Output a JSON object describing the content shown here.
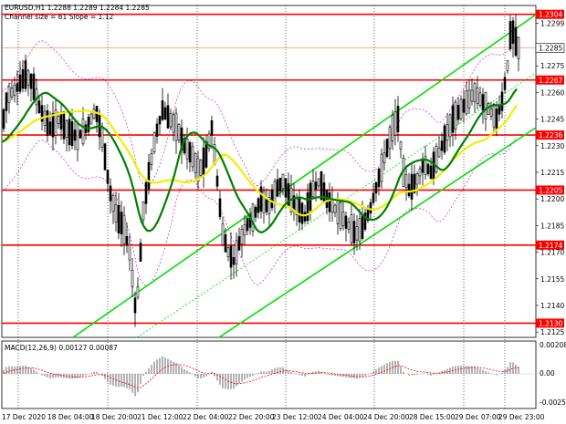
{
  "header": {
    "symbol_line": "EURUSD,H1  1.2288 1.2289 1.2284 1.2285",
    "indicator_line": "Channel size = 61 Slope = 1.12"
  },
  "colors": {
    "bull_candle": "#000000",
    "bear_candle": "#000000",
    "level_line": "#ff0000",
    "channel": "#00e000",
    "ma_yellow": "#f0f000",
    "ma_green": "#008000",
    "bollinger": "#c000c0",
    "macd_hist": "#a0a0a0",
    "macd_signal": "#ff0000",
    "current_price_line": "#ff8040"
  },
  "chart_data": {
    "type": "candlestick",
    "symbol": "EURUSD",
    "timeframe": "H1",
    "ylim": [
      1.2122,
      1.2309
    ],
    "current_price": 1.2285,
    "levels": [
      {
        "label": "1.2304",
        "value": 1.2304
      },
      {
        "label": "1.2267",
        "value": 1.2267
      },
      {
        "label": "1.2236",
        "value": 1.2236
      },
      {
        "label": "1.2205",
        "value": 1.2205
      },
      {
        "label": "1.2174",
        "value": 1.2174
      },
      {
        "label": "1.2130",
        "value": 1.213
      }
    ],
    "y_ticks": [
      "1.2299",
      "1.2285",
      "1.2275",
      "1.2260",
      "1.2245",
      "1.2230",
      "1.2215",
      "1.2200",
      "1.2185",
      "1.2170",
      "1.2155",
      "1.2140",
      "1.2125"
    ],
    "x_ticks": [
      "17 Dec 2020",
      "18 Dec 04:00",
      "18 Dec 20:00",
      "21 Dec 12:00",
      "22 Dec 04:00",
      "22 Dec 20:00",
      "23 Dec 12:00",
      "24 Dec 04:00",
      "24 Dec 20:00",
      "28 Dec 15:00",
      "29 Dec 07:00",
      "29 Dec 23:00"
    ],
    "macd": {
      "label": "MACD(12,26,9) 0.00127 0.00087",
      "ticks": [
        "0.00208",
        "0.00",
        "-0.00251"
      ]
    }
  }
}
